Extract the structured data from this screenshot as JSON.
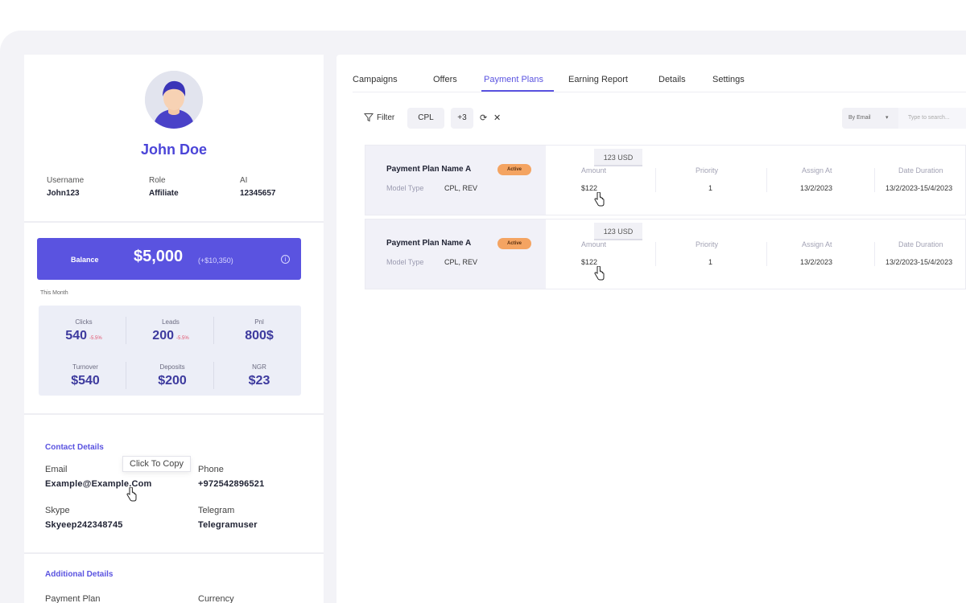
{
  "profile": {
    "name": "John Doe",
    "username_label": "Username",
    "username": "John123",
    "role_label": "Role",
    "role": "Affiliate",
    "id_label": "AI",
    "id": "12345657",
    "balance_label": "Balance",
    "balance": "$5,000",
    "balance_sub": "(+$10,350)",
    "this_month": "This Month",
    "stats": [
      {
        "label": "Clicks",
        "value": "540",
        "delta": "-5.5%"
      },
      {
        "label": "Leads",
        "value": "200",
        "delta": "-5.5%"
      },
      {
        "label": "Pnl",
        "value": "800$",
        "delta": ""
      },
      {
        "label": "Turnover",
        "value": "$540",
        "delta": ""
      },
      {
        "label": "Deposits",
        "value": "$200",
        "delta": ""
      },
      {
        "label": "NGR",
        "value": "$23",
        "delta": ""
      }
    ],
    "contact_title": "Contact Details",
    "email_label": "Email",
    "email": "Example@Example.Com",
    "phone_label": "Phone",
    "phone": "+972542896521",
    "skype_label": "Skype",
    "skype": "Skyeep242348745",
    "telegram_label": "Telegram",
    "telegram": "Telegramuser",
    "copy_tooltip": "Click To Copy",
    "additional_title": "Additional Details",
    "payment_plan_label": "Payment Plan",
    "currency_label": "Currency"
  },
  "tabs": [
    {
      "label": "Campaigns",
      "active": false
    },
    {
      "label": "Offers",
      "active": false
    },
    {
      "label": "Payment Plans",
      "active": true
    },
    {
      "label": "Earning Report",
      "active": false
    },
    {
      "label": "Details",
      "active": false
    },
    {
      "label": "Settings",
      "active": false
    }
  ],
  "toolbar": {
    "filter_label": "Filter",
    "chip": "CPL",
    "more": "+3",
    "sort_label": "By Email",
    "search_placeholder": "Type to search..."
  },
  "columns": {
    "model_type": "Model Type",
    "amount": "Amount",
    "priority": "Priority",
    "assign_at": "Assign At",
    "date_duration": "Date Duration"
  },
  "plans": [
    {
      "name": "Payment Plan Name A",
      "status": "Active",
      "model_type": "CPL, REV",
      "amount": "$122",
      "usd_tooltip": "123 USD",
      "priority": "1",
      "assign_at": "13/2/2023",
      "date_duration": "13/2/2023-15/4/2023"
    },
    {
      "name": "Payment Plan Name A",
      "status": "Active",
      "model_type": "CPL, REV",
      "amount": "$122",
      "usd_tooltip": "123 USD",
      "priority": "1",
      "assign_at": "13/2/2023",
      "date_duration": "13/2/2023-15/4/2023"
    }
  ],
  "colors": {
    "accent": "#5a53e0",
    "badge": "#f4a462",
    "delta_negative": "#e0506a"
  }
}
